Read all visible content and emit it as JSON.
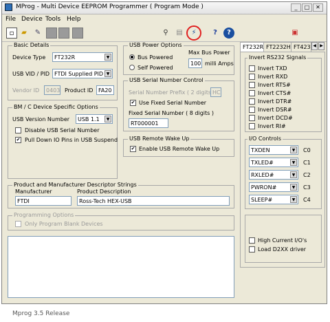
{
  "window": {
    "title": "MProg - Multi Device EEPROM Programmer ( Program Mode )",
    "controls": [
      "_",
      "□",
      "✕"
    ]
  },
  "menu": [
    "File",
    "Device",
    "Tools",
    "Help"
  ],
  "basic": {
    "title": "Basic Details",
    "device_type_label": "Device Type",
    "device_type": "FT232R",
    "vidpid_label": "USB VID / PID",
    "vidpid": "FTDI Supplied PID",
    "vendor_label": "Vendor ID",
    "vendor_value": "0403",
    "product_label": "Product ID",
    "product_value": "FA20"
  },
  "bm": {
    "title": "BM / C Device Specific Options",
    "usb_version_label": "USB Version Number",
    "usb_version": "USB 1.1",
    "disable_serial": "Disable USB Serial Number",
    "pull_down": "Pull Down IO Pins in USB Suspend"
  },
  "power": {
    "title": "USB Power Options",
    "bus_powered": "Bus Powered",
    "self_powered": "Self Powered",
    "max_label": "Max Bus Power",
    "max_value": "100",
    "max_unit": "milli Amps"
  },
  "serial": {
    "title": "USB Serial Number Control",
    "prefix_label": "Serial Number Prefix ( 2 digits )",
    "prefix_value": "HC",
    "use_fixed": "Use Fixed Serial Number",
    "fixed_label": "Fixed Serial Number ( 8 digits )",
    "fixed_value": "RT000001"
  },
  "wake": {
    "title": "USB Remote Wake Up",
    "enable": "Enable USB Remote Wake Up"
  },
  "desc": {
    "title": "Product and Manufacturer Descriptor Strings",
    "manufacturer_label": "Manufacturer",
    "manufacturer": "FTDI",
    "product_label": "Product Description",
    "product": "Ross-Tech HEX-USB"
  },
  "prog": {
    "title": "Programming Options",
    "only_blank": "Only Program Blank Devices"
  },
  "tabs": [
    "FT232R",
    "FT2232H",
    "FT423"
  ],
  "invert": {
    "title": "Invert RS232 Signals",
    "items": [
      "Invert TXD",
      "Invert RXD",
      "Invert RTS#",
      "Invert CTS#",
      "Invert DTR#",
      "Invert DSR#",
      "Invert DCD#",
      "Invert RI#"
    ]
  },
  "io": {
    "title": "I/O Controls",
    "rows": [
      {
        "value": "TXDEN",
        "label": "C0"
      },
      {
        "value": "TXLED#",
        "label": "C1"
      },
      {
        "value": "RXLED#",
        "label": "C2"
      },
      {
        "value": "PWRON#",
        "label": "C3"
      },
      {
        "value": "SLEEP#",
        "label": "C4"
      }
    ]
  },
  "misc": {
    "high_current": "High Current I/O's",
    "load_d2xx": "Load D2XX driver"
  },
  "footer": "Mprog 3.5 Release"
}
